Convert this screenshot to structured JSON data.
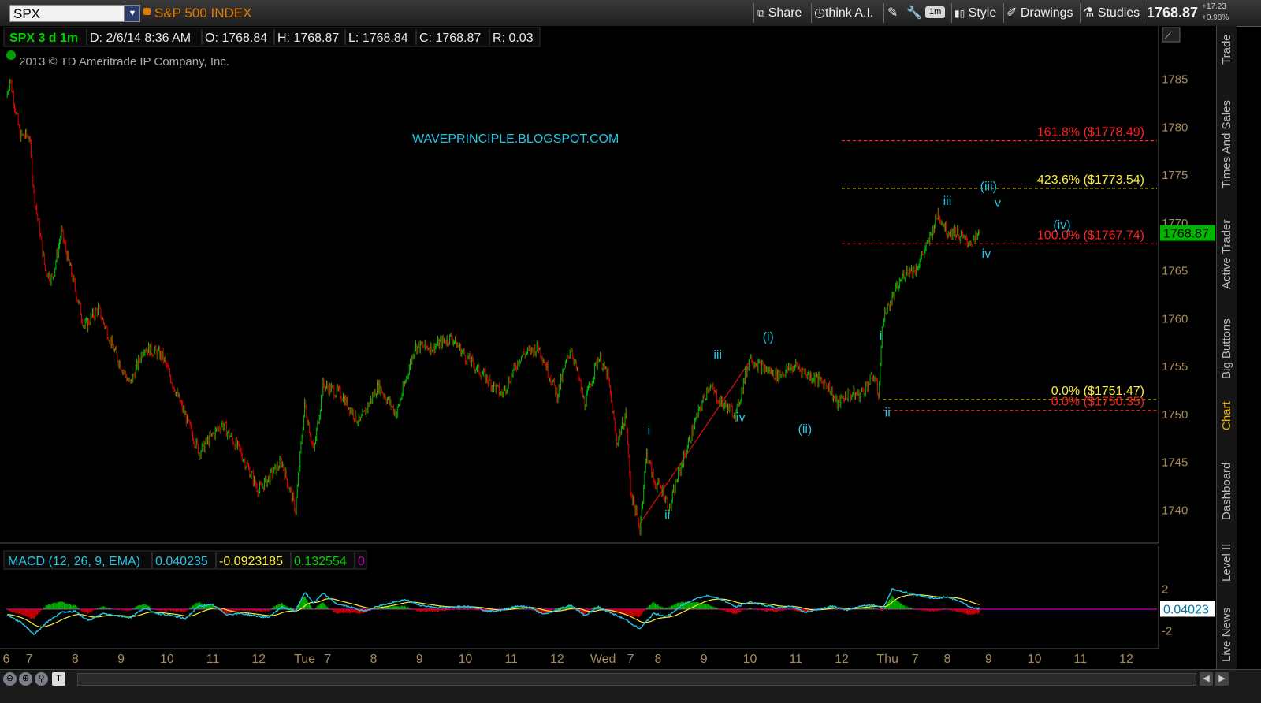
{
  "toolbar": {
    "symbol": "SPX",
    "ticker_name": "S&P 500 INDEX",
    "share": "Share",
    "think_ai": "think A.I.",
    "interval": "1m",
    "style": "Style",
    "drawings": "Drawings",
    "studies": "Studies",
    "last_price": "1768.87",
    "change_pts": "+17.23",
    "change_pct": "+0.98%"
  },
  "header": {
    "symbol_period": "SPX 3 d 1m",
    "date": "D: 2/6/14 8:36 AM",
    "open": "O: 1768.84",
    "high": "H: 1768.87",
    "low": "L: 1768.84",
    "close": "C: 1768.87",
    "range": "R: 0.03",
    "copyright": "2013 © TD Ameritrade IP Company, Inc.",
    "watermark": "WAVEPRINCIPLE.BLOGSPOT.COM"
  },
  "macd_header": {
    "label": "MACD (12, 26, 9, EMA)",
    "value": "0.040235",
    "avg": "-0.0923185",
    "diff": "0.132554",
    "zero": "0"
  },
  "side_tabs": [
    "Trade",
    "Times And Sales",
    "Active Trader",
    "Big Buttons",
    "Chart",
    "Dashboard",
    "Level II",
    "Live News"
  ],
  "colors": {
    "up": "#00c400",
    "down": "#e00000",
    "wave_label": "#22c6e6",
    "fib_red": "#ff2020",
    "fib_yellow": "#ffee33",
    "axis_text": "#a88a5a",
    "price_badge": "#00b400",
    "macd_line": "#22c6e6",
    "macd_avg": "#ffee33",
    "macd_zero": "#c000c0"
  },
  "chart_data": {
    "type": "candlestick",
    "symbol": "SPX",
    "interval": "1m",
    "ylim": [
      1737,
      1788
    ],
    "y_ticks": [
      1740,
      1745,
      1750,
      1755,
      1760,
      1765,
      1770,
      1775,
      1780,
      1785
    ],
    "last_price": 1768.87,
    "last_price_label": "1768.87",
    "x_ticks": [
      {
        "t": 0.0,
        "label": "6"
      },
      {
        "t": 0.5,
        "label": "7"
      },
      {
        "t": 1.5,
        "label": "8"
      },
      {
        "t": 2.5,
        "label": "9"
      },
      {
        "t": 3.5,
        "label": "10"
      },
      {
        "t": 4.5,
        "label": "11"
      },
      {
        "t": 5.5,
        "label": "12"
      },
      {
        "t": 6.5,
        "label": "Tue"
      },
      {
        "t": 7.0,
        "label": "7"
      },
      {
        "t": 8.0,
        "label": "8"
      },
      {
        "t": 9.0,
        "label": "9"
      },
      {
        "t": 10.0,
        "label": "10"
      },
      {
        "t": 11.0,
        "label": "11"
      },
      {
        "t": 12.0,
        "label": "12"
      },
      {
        "t": 13.0,
        "label": "Wed"
      },
      {
        "t": 13.6,
        "label": "7"
      },
      {
        "t": 14.2,
        "label": "8"
      },
      {
        "t": 15.2,
        "label": "9"
      },
      {
        "t": 16.2,
        "label": "10"
      },
      {
        "t": 17.2,
        "label": "11"
      },
      {
        "t": 18.2,
        "label": "12"
      },
      {
        "t": 19.2,
        "label": "Thu"
      },
      {
        "t": 19.8,
        "label": "7"
      },
      {
        "t": 20.5,
        "label": "8"
      },
      {
        "t": 21.4,
        "label": "9"
      },
      {
        "t": 22.4,
        "label": "10"
      },
      {
        "t": 23.4,
        "label": "11"
      },
      {
        "t": 24.4,
        "label": "12"
      }
    ],
    "xlim": [
      0,
      25
    ],
    "price_path": [
      [
        0.0,
        1783
      ],
      [
        0.08,
        1785
      ],
      [
        0.3,
        1779
      ],
      [
        0.5,
        1779
      ],
      [
        0.6,
        1773
      ],
      [
        0.85,
        1765
      ],
      [
        1.0,
        1764
      ],
      [
        1.2,
        1769
      ],
      [
        1.4,
        1765
      ],
      [
        1.7,
        1759
      ],
      [
        2.0,
        1761
      ],
      [
        2.4,
        1756
      ],
      [
        2.7,
        1753
      ],
      [
        3.0,
        1757
      ],
      [
        3.4,
        1756
      ],
      [
        3.8,
        1751
      ],
      [
        4.2,
        1746
      ],
      [
        4.7,
        1749
      ],
      [
        5.1,
        1746
      ],
      [
        5.5,
        1742
      ],
      [
        6.0,
        1745
      ],
      [
        6.3,
        1740
      ],
      [
        6.5,
        1751
      ],
      [
        6.7,
        1746
      ],
      [
        6.9,
        1753
      ],
      [
        7.3,
        1752
      ],
      [
        7.7,
        1749
      ],
      [
        8.1,
        1753
      ],
      [
        8.5,
        1750
      ],
      [
        8.9,
        1757
      ],
      [
        9.3,
        1757
      ],
      [
        9.7,
        1758
      ],
      [
        10.0,
        1756
      ],
      [
        10.4,
        1754
      ],
      [
        10.8,
        1752
      ],
      [
        11.2,
        1756
      ],
      [
        11.6,
        1757
      ],
      [
        12.0,
        1752
      ],
      [
        12.3,
        1757
      ],
      [
        12.6,
        1751
      ],
      [
        12.9,
        1756
      ],
      [
        13.1,
        1754
      ],
      [
        13.3,
        1747
      ],
      [
        13.5,
        1750
      ],
      [
        13.6,
        1742
      ],
      [
        13.8,
        1738
      ],
      [
        13.95,
        1746
      ],
      [
        14.1,
        1743
      ],
      [
        14.3,
        1742
      ],
      [
        14.45,
        1740
      ],
      [
        14.6,
        1743
      ],
      [
        14.8,
        1746
      ],
      [
        15.0,
        1749
      ],
      [
        15.3,
        1753
      ],
      [
        15.6,
        1751
      ],
      [
        15.9,
        1750
      ],
      [
        16.2,
        1756
      ],
      [
        16.4,
        1755
      ],
      [
        16.8,
        1754
      ],
      [
        17.2,
        1755
      ],
      [
        17.5,
        1754
      ],
      [
        17.9,
        1753
      ],
      [
        18.1,
        1751
      ],
      [
        18.3,
        1752
      ],
      [
        18.6,
        1752
      ],
      [
        18.9,
        1754
      ],
      [
        19.0,
        1752
      ],
      [
        19.1,
        1760
      ],
      [
        19.3,
        1762
      ],
      [
        19.6,
        1765
      ],
      [
        19.8,
        1765
      ],
      [
        20.1,
        1768
      ],
      [
        20.3,
        1771
      ],
      [
        20.5,
        1769
      ],
      [
        20.7,
        1769
      ],
      [
        20.9,
        1768
      ],
      [
        21.1,
        1768
      ],
      [
        21.2,
        1768.87
      ]
    ],
    "fib_levels": [
      {
        "label": "161.8%",
        "price_text": "($1778.49)",
        "price": 1778.49,
        "color": "red",
        "t_start": 18.2
      },
      {
        "label": "423.6%",
        "price_text": "($1773.54)",
        "price": 1773.54,
        "color": "yellow",
        "t_start": 18.2
      },
      {
        "label": "100.0%",
        "price_text": "($1767.74)",
        "price": 1767.74,
        "color": "red",
        "t_start": 18.2
      },
      {
        "label": "0.0%",
        "price_text": "($1751.47)",
        "price": 1751.47,
        "color": "yellow",
        "t_start": 19.1
      },
      {
        "label": "0.0%",
        "price_text": "($1750.35)",
        "price": 1750.35,
        "color": "red",
        "t_start": 19.1
      }
    ],
    "wave_labels": [
      {
        "text": "i",
        "t": 14.0,
        "price": 1747.8
      },
      {
        "text": "ii",
        "t": 14.4,
        "price": 1739.0
      },
      {
        "text": "iii",
        "t": 15.5,
        "price": 1755.7
      },
      {
        "text": "iv",
        "t": 16.0,
        "price": 1749.2
      },
      {
        "text": "(i)",
        "t": 16.6,
        "price": 1757.6
      },
      {
        "text": "(ii)",
        "t": 17.4,
        "price": 1748.0
      },
      {
        "text": "i",
        "t": 19.05,
        "price": 1757.7
      },
      {
        "text": "ii",
        "t": 19.2,
        "price": 1749.7
      },
      {
        "text": "iii",
        "t": 20.5,
        "price": 1771.8
      },
      {
        "text": "(iii)",
        "t": 21.4,
        "price": 1773.3
      },
      {
        "text": "v",
        "t": 21.6,
        "price": 1771.6
      },
      {
        "text": "(iv)",
        "t": 23.0,
        "price": 1769.3
      },
      {
        "text": "iv",
        "t": 21.35,
        "price": 1766.3
      }
    ],
    "trendline": {
      "t1": 13.8,
      "p1": 1738.5,
      "t2": 16.2,
      "p2": 1755.5
    },
    "macd": {
      "ylim": [
        -3,
        3
      ],
      "y_ticks": [
        2,
        -2
      ],
      "current_label": "0.04023",
      "path": [
        [
          0.0,
          -0.5
        ],
        [
          0.3,
          -1.2
        ],
        [
          0.6,
          -2.4
        ],
        [
          0.9,
          -1.2
        ],
        [
          1.2,
          -0.3
        ],
        [
          1.5,
          -0.2
        ],
        [
          1.8,
          -1.1
        ],
        [
          2.1,
          -0.4
        ],
        [
          2.4,
          -0.6
        ],
        [
          2.7,
          -0.8
        ],
        [
          3.0,
          0.1
        ],
        [
          3.3,
          -0.4
        ],
        [
          3.6,
          -0.6
        ],
        [
          3.9,
          -0.9
        ],
        [
          4.2,
          0.3
        ],
        [
          4.5,
          0.4
        ],
        [
          4.8,
          -0.5
        ],
        [
          5.1,
          -0.4
        ],
        [
          5.4,
          -0.6
        ],
        [
          5.7,
          -0.8
        ],
        [
          6.0,
          0.2
        ],
        [
          6.3,
          -0.2
        ],
        [
          6.5,
          1.6
        ],
        [
          6.7,
          0.6
        ],
        [
          6.9,
          1.5
        ],
        [
          7.2,
          0.5
        ],
        [
          7.5,
          0.2
        ],
        [
          7.8,
          -0.2
        ],
        [
          8.1,
          0.3
        ],
        [
          8.4,
          0.6
        ],
        [
          8.7,
          0.9
        ],
        [
          9.0,
          0.4
        ],
        [
          9.3,
          0.2
        ],
        [
          9.6,
          0.1
        ],
        [
          9.9,
          0.3
        ],
        [
          10.2,
          0.2
        ],
        [
          10.5,
          -0.2
        ],
        [
          10.8,
          -0.1
        ],
        [
          11.1,
          0.3
        ],
        [
          11.4,
          0.2
        ],
        [
          11.7,
          -0.5
        ],
        [
          12.0,
          -0.1
        ],
        [
          12.3,
          0.4
        ],
        [
          12.6,
          -0.6
        ],
        [
          12.9,
          0.2
        ],
        [
          13.2,
          -0.4
        ],
        [
          13.5,
          -1.0
        ],
        [
          13.8,
          -1.9
        ],
        [
          14.1,
          -0.4
        ],
        [
          14.4,
          -0.7
        ],
        [
          14.7,
          0.3
        ],
        [
          15.0,
          1.0
        ],
        [
          15.3,
          1.3
        ],
        [
          15.6,
          0.9
        ],
        [
          15.9,
          0.2
        ],
        [
          16.2,
          0.7
        ],
        [
          16.5,
          0.4
        ],
        [
          16.8,
          0.1
        ],
        [
          17.1,
          0.3
        ],
        [
          17.4,
          -0.3
        ],
        [
          17.7,
          0.0
        ],
        [
          18.0,
          0.3
        ],
        [
          18.3,
          -0.1
        ],
        [
          18.6,
          0.3
        ],
        [
          18.9,
          0.4
        ],
        [
          19.1,
          0.1
        ],
        [
          19.3,
          1.9
        ],
        [
          19.6,
          1.6
        ],
        [
          19.9,
          1.3
        ],
        [
          20.2,
          1.0
        ],
        [
          20.5,
          1.2
        ],
        [
          20.8,
          0.7
        ],
        [
          21.0,
          0.2
        ],
        [
          21.2,
          0.04
        ]
      ],
      "avg_offset": 0.35
    }
  }
}
